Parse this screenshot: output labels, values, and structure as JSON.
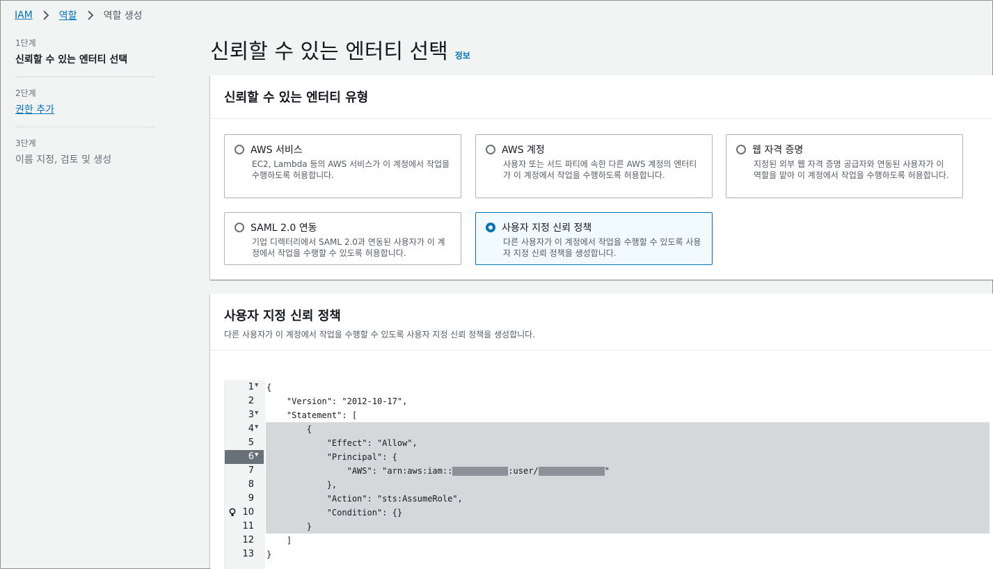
{
  "breadcrumb": {
    "items": [
      {
        "label": "IAM",
        "link": true
      },
      {
        "label": "역할",
        "link": true
      },
      {
        "label": "역할 생성",
        "link": false
      }
    ]
  },
  "steps": [
    {
      "num": "1단계",
      "label": "신뢰할 수 있는 엔터티 선택",
      "state": "active"
    },
    {
      "num": "2단계",
      "label": "권한 추가",
      "state": "link"
    },
    {
      "num": "3단계",
      "label": "이름 지정, 검토 및 생성",
      "state": "disabled"
    }
  ],
  "page": {
    "title": "신뢰할 수 있는 엔터티 선택",
    "info_link": "정보"
  },
  "entity_type": {
    "heading": "신뢰할 수 있는 엔터티 유형",
    "tiles": [
      {
        "title": "AWS 서비스",
        "desc": "EC2, Lambda 등의 AWS 서비스가 이 계정에서 작업을 수행하도록 허용합니다.",
        "selected": false
      },
      {
        "title": "AWS 계정",
        "desc": "사용자 또는 서드 파티에 속한 다른 AWS 계정의 엔터티가 이 계정에서 작업을 수행하도록 허용합니다.",
        "selected": false
      },
      {
        "title": "웹 자격 증명",
        "desc": "지정된 외부 웹 자격 증명 공급자와 연동된 사용자가 이 역할을 맡아 이 계정에서 작업을 수행하도록 허용합니다.",
        "selected": false
      },
      {
        "title": "SAML 2.0 연동",
        "desc": "기업 디렉터리에서 SAML 2.0과 연동된 사용자가 이 계정에서 작업을 수행할 수 있도록 허용합니다.",
        "selected": false
      },
      {
        "title": "사용자 지정 신뢰 정책",
        "desc": "다른 사용자가 이 계정에서 작업을 수행할 수 있도록 사용자 지정 신뢰 정책을 생성합니다.",
        "selected": true
      }
    ]
  },
  "custom_policy": {
    "heading": "사용자 지정 신뢰 정책",
    "subtitle": "다른 사용자가 이 계정에서 작업을 수행할 수 있도록 사용자 지정 신뢰 정책을 생성합니다.",
    "editor": {
      "active_line": 6,
      "lines": [
        {
          "n": "1",
          "fold": true,
          "code": "{"
        },
        {
          "n": "2",
          "fold": false,
          "code": "    \"Version\": \"2012-10-17\","
        },
        {
          "n": "3",
          "fold": true,
          "code": "    \"Statement\": ["
        },
        {
          "n": "4",
          "fold": true,
          "code": "        {"
        },
        {
          "n": "5",
          "fold": false,
          "code": "            \"Effect\": \"Allow\","
        },
        {
          "n": "6",
          "fold": true,
          "code": "            \"Principal\": {"
        },
        {
          "n": "7",
          "fold": false,
          "code_prefix": "                \"AWS\": \"arn:aws:iam::",
          "code_mid": ":user/",
          "code_suffix": "\""
        },
        {
          "n": "8",
          "fold": false,
          "code": "            },"
        },
        {
          "n": "9",
          "fold": false,
          "code": "            \"Action\": \"sts:AssumeRole\","
        },
        {
          "n": "10",
          "fold": false,
          "bulb": true,
          "code": "            \"Condition\": {}"
        },
        {
          "n": "11",
          "fold": false,
          "code": "        }"
        },
        {
          "n": "12",
          "fold": false,
          "code": "    ]"
        },
        {
          "n": "13",
          "fold": false,
          "code": "}"
        }
      ]
    }
  },
  "colors": {
    "link": "#0073bb",
    "selected_border": "#0073bb",
    "selected_bg": "#f1faff",
    "background": "#f2f3f3"
  }
}
